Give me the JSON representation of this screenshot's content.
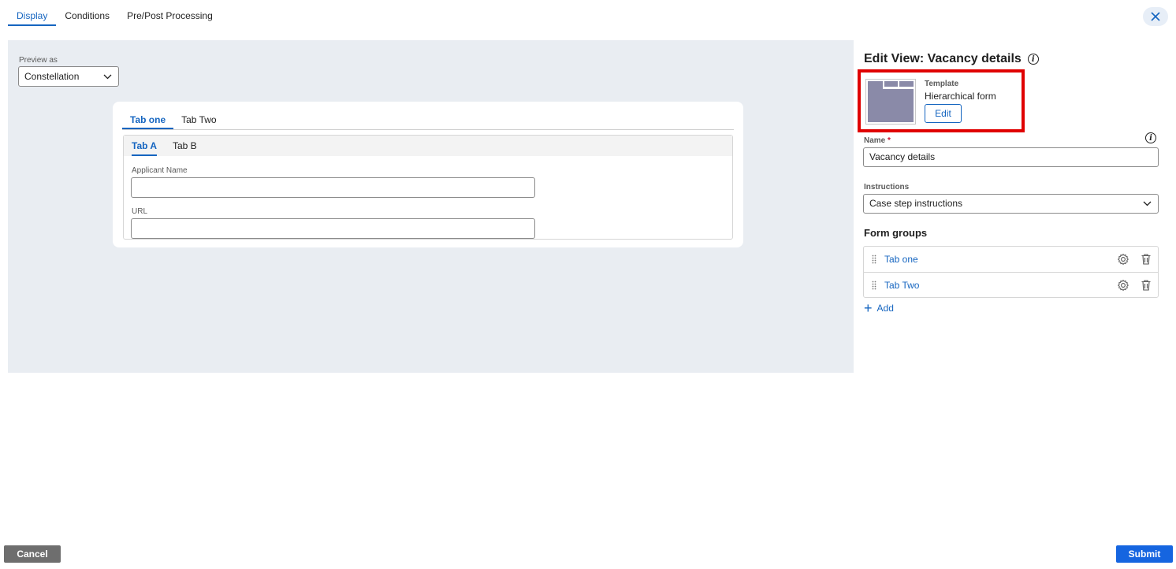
{
  "top_tabs": [
    {
      "label": "Display",
      "active": true
    },
    {
      "label": "Conditions",
      "active": false
    },
    {
      "label": "Pre/Post Processing",
      "active": false
    }
  ],
  "preview": {
    "label": "Preview as",
    "selected": "Constellation",
    "card_tabs": [
      {
        "label": "Tab one",
        "active": true
      },
      {
        "label": "Tab Two",
        "active": false
      }
    ],
    "inner_tabs": [
      {
        "label": "Tab A",
        "active": true
      },
      {
        "label": "Tab B",
        "active": false
      }
    ],
    "fields": [
      {
        "label": "Applicant Name",
        "value": ""
      },
      {
        "label": "URL",
        "value": ""
      }
    ]
  },
  "panel": {
    "title": "Edit View: Vacancy details",
    "template": {
      "label": "Template",
      "value": "Hierarchical form",
      "edit_label": "Edit"
    },
    "name": {
      "label": "Name",
      "required_mark": "*",
      "value": "Vacancy details"
    },
    "instructions": {
      "label": "Instructions",
      "value": "Case step instructions"
    },
    "form_groups": {
      "title": "Form groups",
      "items": [
        {
          "label": "Tab one"
        },
        {
          "label": "Tab Two"
        }
      ],
      "add_label": "Add"
    }
  },
  "footer": {
    "cancel_label": "Cancel",
    "submit_label": "Submit"
  },
  "colors": {
    "accent": "#1565c0",
    "highlight": "#e00000",
    "submit": "#1565e0",
    "cancel": "#6e6e6e"
  }
}
